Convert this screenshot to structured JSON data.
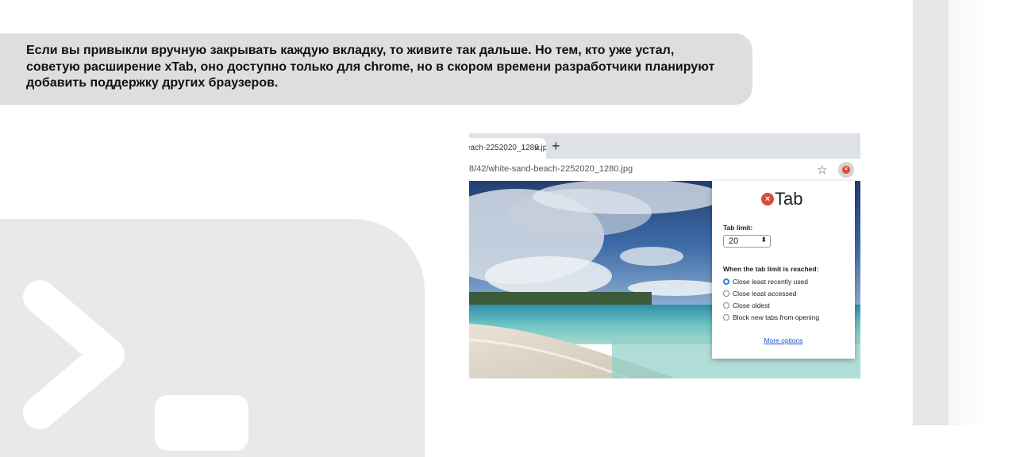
{
  "message": {
    "text": "Если вы привыкли вручную закрывать каждую вкладку, то живите так дальше. Но тем, кто уже устал, советую расширение xTab, оно доступно только для chrome, но в скором времени разработчики планируют добавить поддержку других браузеров."
  },
  "browser": {
    "tab_title": "each-2252020_1280.jpg",
    "tab_close_icon": "close-icon",
    "new_tab_symbol": "+",
    "url": "8/42/white-sand-beach-2252020_1280.jpg",
    "star_symbol": "☆",
    "extension_icon": "xtab-icon"
  },
  "popup": {
    "brand_symbol": "×",
    "brand_name": "Tab",
    "tab_limit_label": "Tab limit:",
    "tab_limit_value": "20",
    "select_arrows": "⬍",
    "when_label": "When the tab limit is reached:",
    "options": [
      {
        "label": "Close least recently used",
        "selected": true
      },
      {
        "label": "Close least accessed",
        "selected": false
      },
      {
        "label": "Close oldest",
        "selected": false
      },
      {
        "label": "Block new tabs from opening",
        "selected": false
      }
    ],
    "more_options": "More options"
  },
  "colors": {
    "bubble": "#dedede",
    "brand_red": "#d94a3b",
    "radio_blue": "#2f7de1",
    "link_blue": "#1a55c4"
  }
}
